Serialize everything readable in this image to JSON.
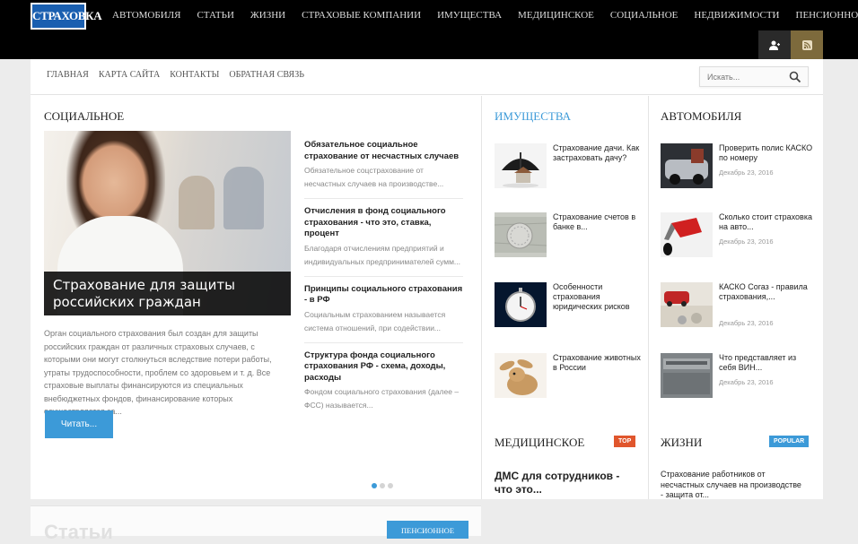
{
  "logo": {
    "text": "СТРАХОВКА"
  },
  "main_nav": [
    "Автомобиля",
    "Статьи",
    "Жизни",
    "Страховые компании",
    "Имущества",
    "Медицинское",
    "Социальное",
    "Недвижимости",
    "Пенсионное"
  ],
  "header_icons": {
    "user": "user-icon",
    "rss": "rss-icon"
  },
  "sub_nav": [
    "Главная",
    "Карта сайта",
    "Контакты",
    "Обратная связь"
  ],
  "search": {
    "placeholder": "Искать...",
    "icon": "search-icon"
  },
  "social": {
    "title": "Социальное",
    "feature": {
      "caption": "Страхование для защиты российских граждан",
      "excerpt": "Орган социального страхования был создан для защиты российских граждан от различных страховых случаев, с которыми они могут столкнуться вследствие потери работы, утраты трудоспособности, проблем со здоровьем и т. д. Все страховые выплаты финансируются из специальных внебюджетных фондов, финансирование которых осуществляется за...",
      "button": "Читать..."
    },
    "list": [
      {
        "title": "Обязательное социальное страхование от несчастных случаев",
        "excerpt": "Обязательное соцстрахование от несчастных случаев на производстве..."
      },
      {
        "title": "Отчисления в фонд социального страхования - что это, ставка, процент",
        "excerpt": "Благодаря отчислениям предприятий и индивидуальных предпринимателей сумм..."
      },
      {
        "title": "Принципы социального страхования - в РФ",
        "excerpt": "Социальным страхованием называется система отношений, при содействии..."
      },
      {
        "title": "Структура фонда социального страхования РФ - схема, доходы, расходы",
        "excerpt": "Фондом социального страхования (далее – ФСС) называется..."
      }
    ]
  },
  "property": {
    "title": "Имущества",
    "items": [
      {
        "title": "Страхование дачи. Как застраховать дачу?"
      },
      {
        "title": "Страхование счетов в банке в..."
      },
      {
        "title": "Особенности страхования юридических рисков"
      },
      {
        "title": "Страхование животных в России"
      }
    ]
  },
  "auto": {
    "title": "Автомобиля",
    "items": [
      {
        "title": "Проверить полис КАСКО по номеру",
        "date": "Декабрь 23, 2016"
      },
      {
        "title": "Сколько стоит страховка на авто...",
        "date": "Декабрь 23, 2016"
      },
      {
        "title": "КАСКО Согаз - правила страхования,...",
        "date": "Декабрь 23, 2016"
      },
      {
        "title": "Что представляет из себя ВИН...",
        "date": "Декабрь 23, 2016"
      }
    ]
  },
  "medical": {
    "title": "Медицинское",
    "badge": "TOP",
    "first": "ДМС для сотрудников - что это..."
  },
  "life": {
    "title": "Жизни",
    "badge": "POPULAR",
    "first": "Страхование работников от несчастных случаев на производстве - защита от..."
  },
  "bottom": {
    "stat_title": "Статьи",
    "button": "Пенсионное"
  },
  "colors": {
    "accent": "#3c9ad8",
    "top_badge": "#e0562d",
    "header": "#000000",
    "rss": "#7d6a3c"
  }
}
